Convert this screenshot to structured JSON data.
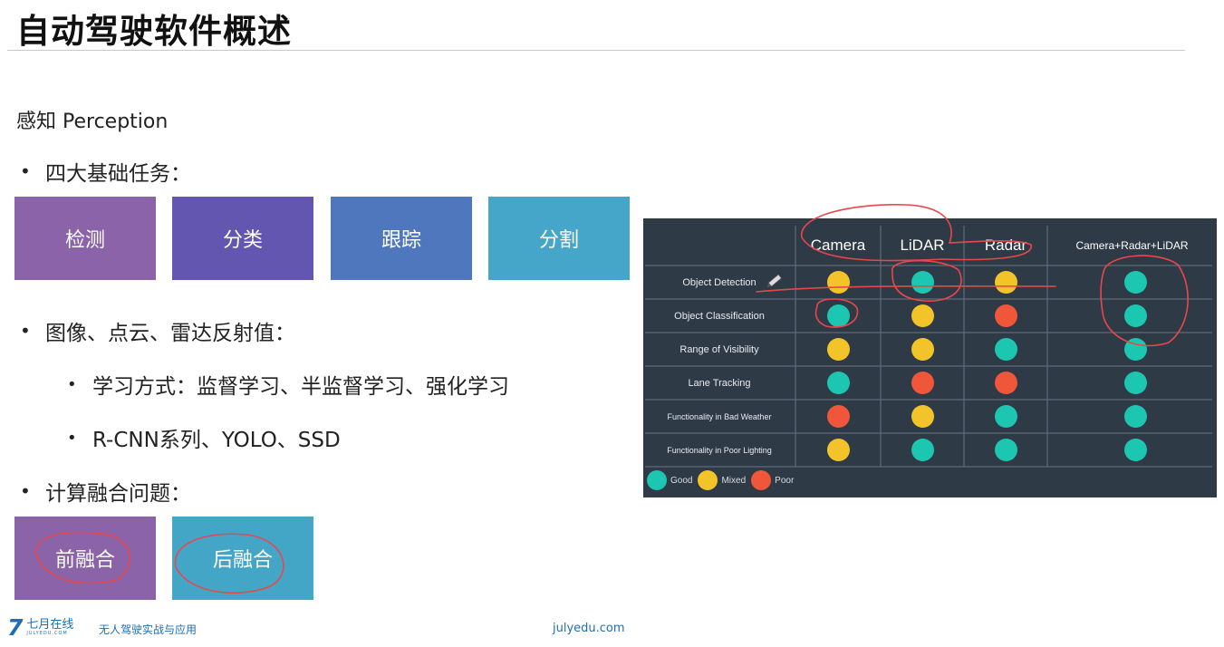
{
  "slide": {
    "title": "自动驾驶软件概述",
    "subtitle": "感知 Perception",
    "bullets": [
      "四大基础任务：",
      "图像、点云、雷达反射值：",
      "计算融合问题："
    ],
    "sub_bullets": [
      "学习方式：监督学习、半监督学习、强化学习",
      "R-CNN系列、YOLO、SSD"
    ],
    "bullet_glyph": "•",
    "tasks": [
      {
        "label": "检测",
        "color": "#8a63a8"
      },
      {
        "label": "分类",
        "color": "#6356b0"
      },
      {
        "label": "跟踪",
        "color": "#4f77be"
      },
      {
        "label": "分割",
        "color": "#45a6c9"
      }
    ],
    "fusion": [
      {
        "label": "前融合",
        "color": "#8a63a8"
      },
      {
        "label": "后融合",
        "color": "#44a6c7"
      }
    ]
  },
  "matrix": {
    "columns": [
      "Camera",
      "LiDAR",
      "Radar",
      "Camera+Radar+LiDAR"
    ],
    "rows": [
      {
        "label": "Object Detection",
        "ratings": [
          "mixed",
          "good",
          "mixed",
          "good"
        ]
      },
      {
        "label": "Object Classification",
        "ratings": [
          "good",
          "mixed",
          "poor",
          "good"
        ]
      },
      {
        "label": "Range of Visibility",
        "ratings": [
          "mixed",
          "mixed",
          "good",
          "good"
        ]
      },
      {
        "label": "Lane Tracking",
        "ratings": [
          "good",
          "poor",
          "poor",
          "good"
        ]
      },
      {
        "label": "Functionality in Bad Weather",
        "ratings": [
          "poor",
          "mixed",
          "good",
          "good"
        ]
      },
      {
        "label": "Functionality in Poor Lighting",
        "ratings": [
          "mixed",
          "good",
          "good",
          "good"
        ]
      }
    ],
    "legend": [
      {
        "key": "good",
        "label": "Good"
      },
      {
        "key": "mixed",
        "label": "Mixed"
      },
      {
        "key": "poor",
        "label": "Poor"
      }
    ],
    "colors": {
      "good": "#1cc6b0",
      "mixed": "#f3c42a",
      "poor": "#f0573a",
      "background": "#2f3a47",
      "gridline": "#5d6b79"
    },
    "annotation_color": "#e8474b"
  },
  "footer": {
    "logo_mark": "7",
    "brand": "七月在线",
    "brand_en": "JULYEDU.COM",
    "course": "无人驾驶实战与应用",
    "url": "julyedu.com"
  }
}
